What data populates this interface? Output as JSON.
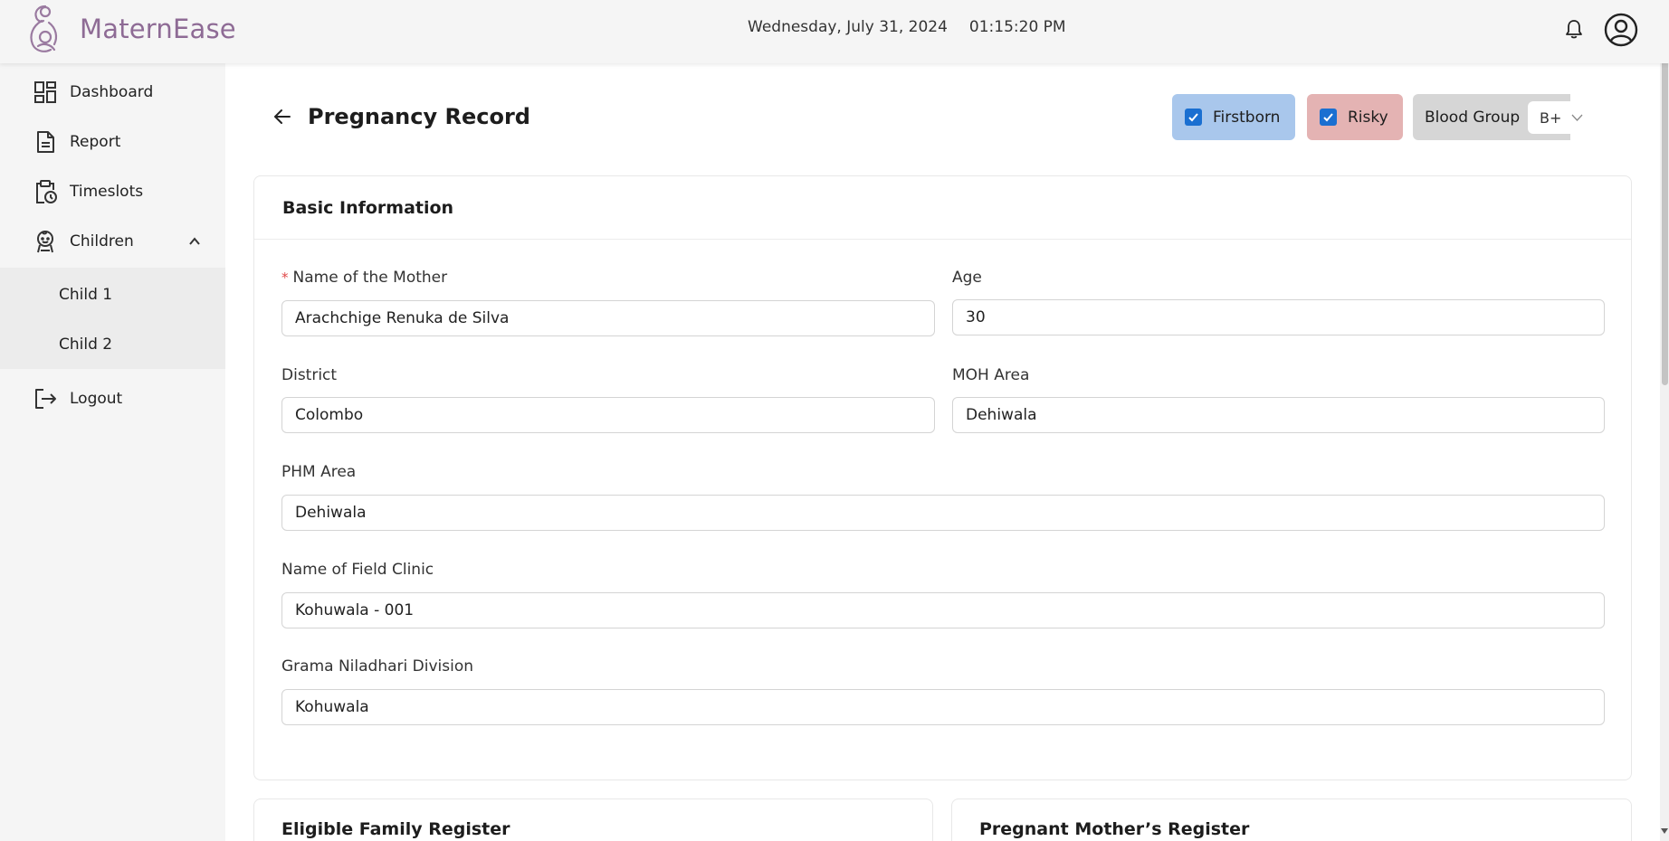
{
  "header": {
    "brand": "MaternEase",
    "date": "Wednesday, July 31, 2024",
    "time": "01:15:20 PM",
    "icons": {
      "logo": "mother-baby-logo",
      "notifications": "bell-icon",
      "profile": "user-circle-icon"
    }
  },
  "sidebar": {
    "items": [
      {
        "label": "Dashboard",
        "icon": "dashboard-icon"
      },
      {
        "label": "Report",
        "icon": "document-icon"
      },
      {
        "label": "Timeslots",
        "icon": "clipboard-clock-icon"
      },
      {
        "label": "Children",
        "icon": "baby-icon",
        "expanded": true
      },
      {
        "label": "Logout",
        "icon": "logout-icon"
      }
    ],
    "children": [
      {
        "label": "Child 1"
      },
      {
        "label": "Child 2"
      }
    ]
  },
  "page": {
    "title": "Pregnancy Record",
    "flags": {
      "firstborn": {
        "label": "Firstborn",
        "checked": true,
        "color": "#a9c7ec"
      },
      "risky": {
        "label": "Risky",
        "checked": true,
        "color": "#e4b3b3"
      }
    },
    "blood_group": {
      "label": "Blood Group",
      "value": "B+"
    }
  },
  "basic_info": {
    "title": "Basic Information",
    "fields": {
      "mother_name": {
        "label": "Name of the Mother",
        "value": "Arachchige Renuka de Silva",
        "required": true
      },
      "age": {
        "label": "Age",
        "value": "30"
      },
      "district": {
        "label": "District",
        "value": "Colombo"
      },
      "moh_area": {
        "label": "MOH Area",
        "value": "Dehiwala"
      },
      "phm_area": {
        "label": "PHM Area",
        "value": "Dehiwala"
      },
      "field_clinic": {
        "label": "Name of Field Clinic",
        "value": "Kohuwala - 001"
      },
      "gn_division": {
        "label": "Grama Niladhari Division",
        "value": "Kohuwala"
      }
    }
  },
  "sections": {
    "eligible_family": "Eligible Family Register",
    "pregnant_mother": "Pregnant Mother’s Register"
  },
  "colors": {
    "brand": "#8e6b95",
    "checkbox": "#1a6fd1",
    "required": "#e04848"
  }
}
